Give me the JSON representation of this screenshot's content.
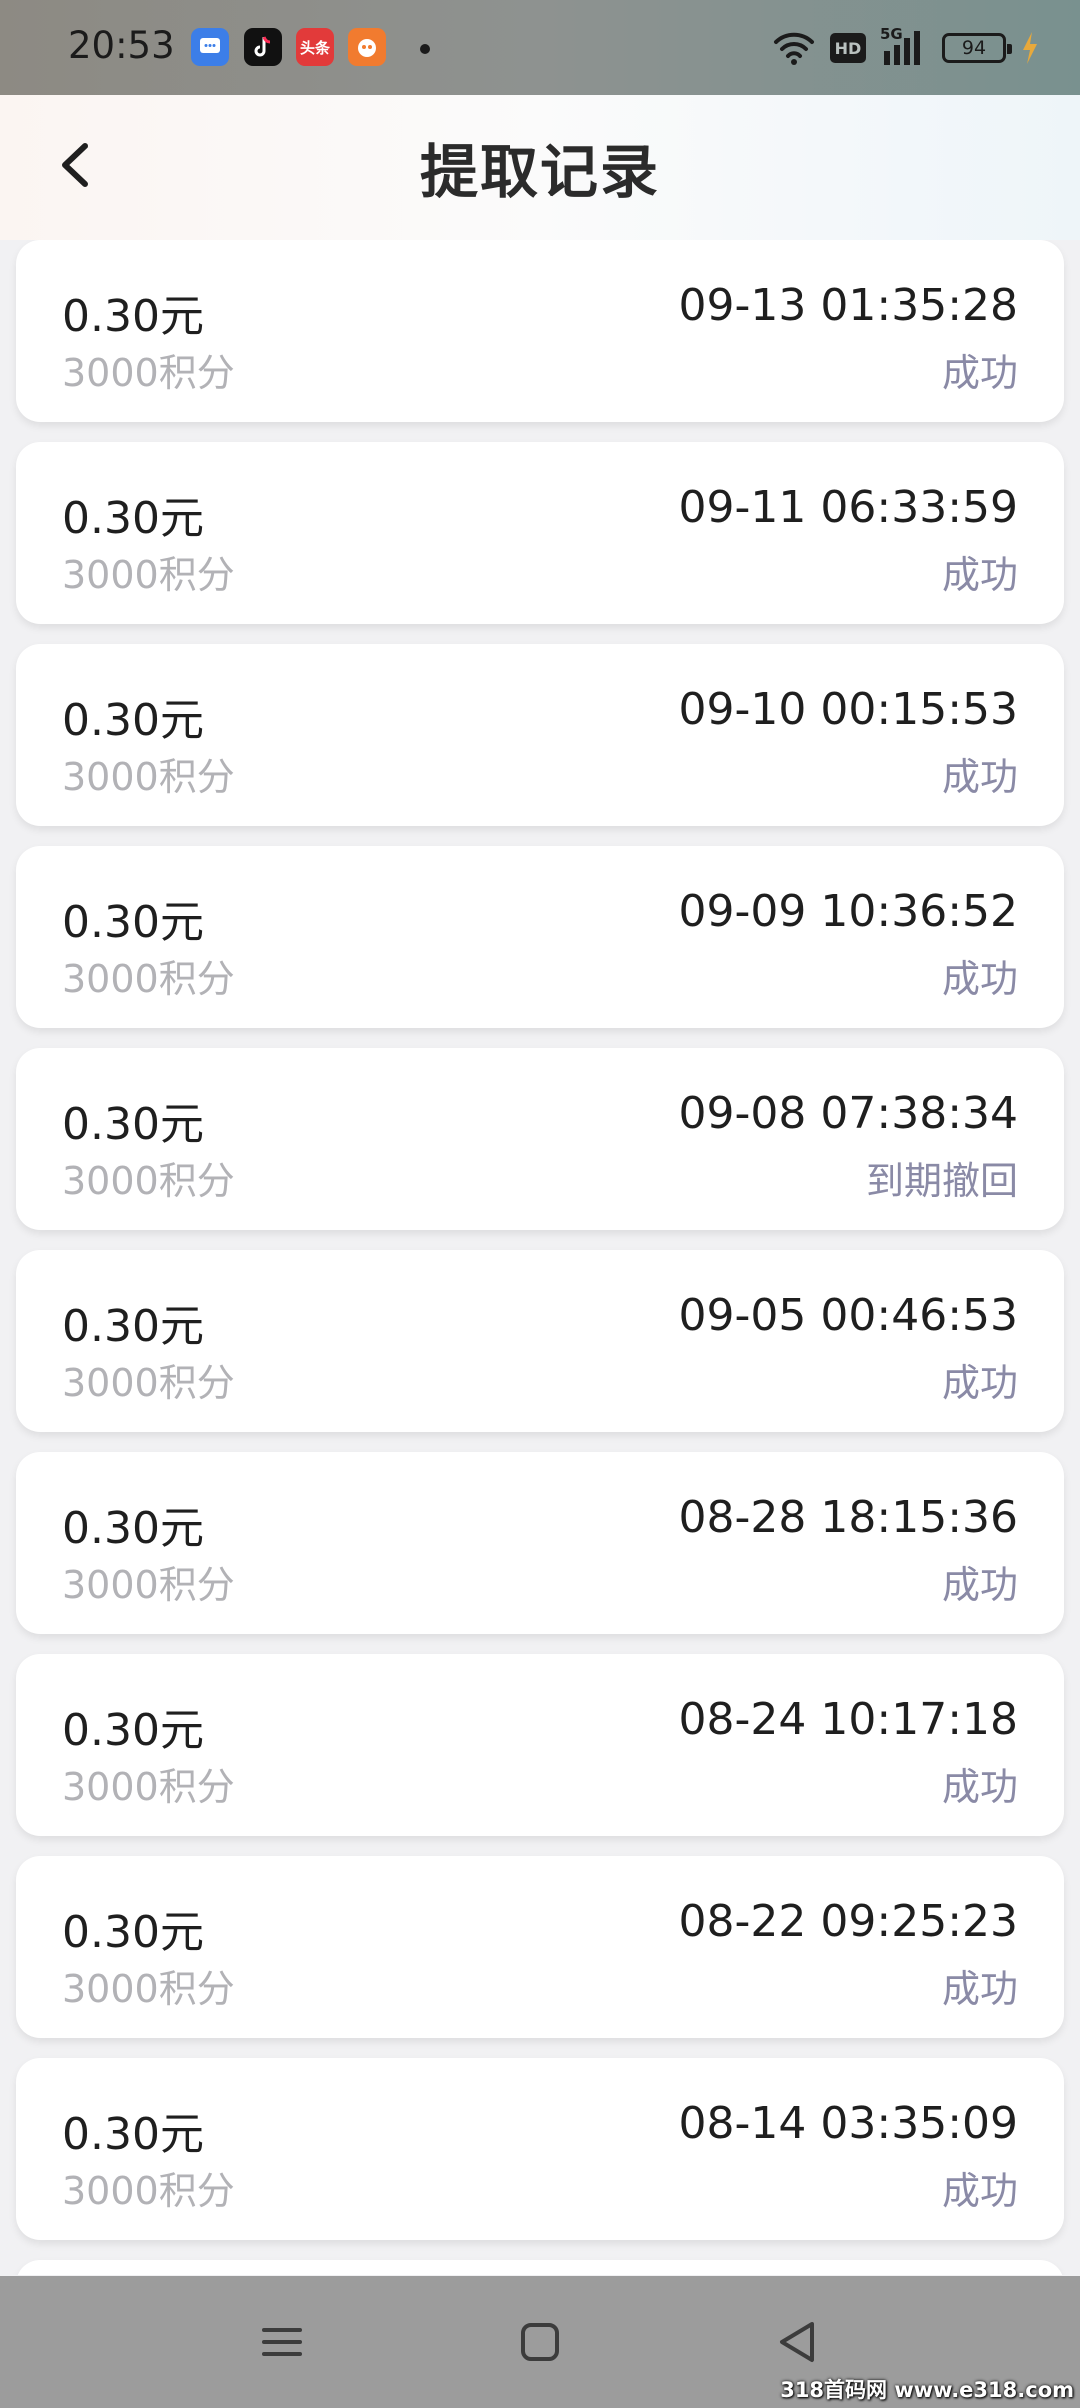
{
  "status_bar": {
    "time": "20:53",
    "notifications": [
      "message-app-icon",
      "tiktok-icon",
      "toutiao-icon",
      "game-app-icon"
    ],
    "toutiao_label": "头条",
    "hd": "HD",
    "network": "5G",
    "battery": "94"
  },
  "header": {
    "title": "提取记录",
    "back_icon": "chevron-left-icon"
  },
  "records": [
    {
      "amount": "0.30元",
      "points": "3000积分",
      "time": "09-13 01:35:28",
      "status": "成功"
    },
    {
      "amount": "0.30元",
      "points": "3000积分",
      "time": "09-11 06:33:59",
      "status": "成功"
    },
    {
      "amount": "0.30元",
      "points": "3000积分",
      "time": "09-10 00:15:53",
      "status": "成功"
    },
    {
      "amount": "0.30元",
      "points": "3000积分",
      "time": "09-09 10:36:52",
      "status": "成功"
    },
    {
      "amount": "0.30元",
      "points": "3000积分",
      "time": "09-08 07:38:34",
      "status": "到期撤回"
    },
    {
      "amount": "0.30元",
      "points": "3000积分",
      "time": "09-05 00:46:53",
      "status": "成功"
    },
    {
      "amount": "0.30元",
      "points": "3000积分",
      "time": "08-28 18:15:36",
      "status": "成功"
    },
    {
      "amount": "0.30元",
      "points": "3000积分",
      "time": "08-24 10:17:18",
      "status": "成功"
    },
    {
      "amount": "0.30元",
      "points": "3000积分",
      "time": "08-22 09:25:23",
      "status": "成功"
    },
    {
      "amount": "0.30元",
      "points": "3000积分",
      "time": "08-14 03:35:09",
      "status": "成功"
    }
  ],
  "nav_bar": {
    "icons": [
      "menu-icon",
      "home-icon",
      "back-triangle-icon"
    ]
  },
  "watermark": "318首码网 www.e318.com",
  "colors": {
    "status_text": "#8a8aa6",
    "points_text": "#b2b2b6",
    "card_bg": "#ffffff",
    "page_bg": "#f1f1f3"
  }
}
